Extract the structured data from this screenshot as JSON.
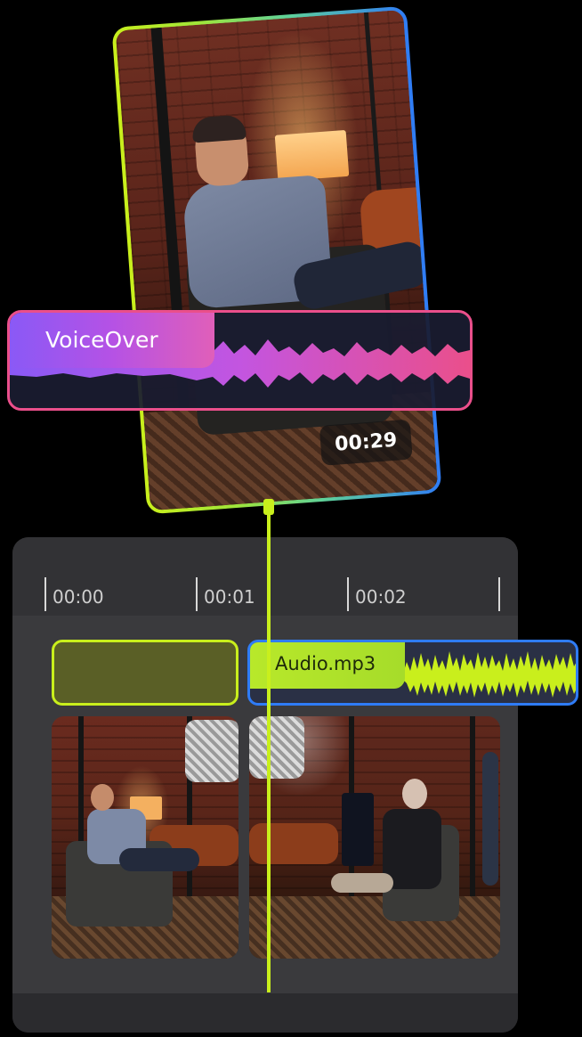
{
  "preview": {
    "timestamp": "00:29"
  },
  "voiceover_track": {
    "label": "VoiceOver",
    "accent_start": "#8a59f6",
    "accent_end": "#ea4f8b"
  },
  "timeline": {
    "ruler_labels": [
      "00:00",
      "00:01",
      "00:02"
    ],
    "audio_track": {
      "label": "Audio.mp3",
      "accent": "#c9ef1c",
      "border": "#2f7cf6"
    },
    "video_clips": [
      "interview-man",
      "interview-woman"
    ],
    "playhead_color": "#c9ef1c"
  }
}
